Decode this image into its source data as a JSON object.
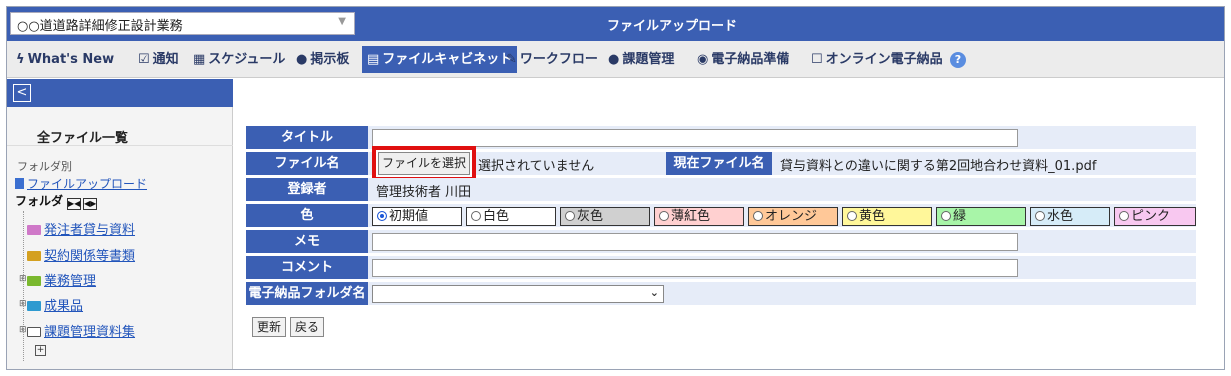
{
  "header": {
    "project": "○○道道路詳細修正設計業務",
    "page_title": "ファイルアップロード"
  },
  "nav": {
    "items": [
      {
        "icon": "ϟ",
        "label": "What's New"
      },
      {
        "icon": "☑",
        "label": "通知"
      },
      {
        "icon": "▦",
        "label": "スケジュール"
      },
      {
        "icon": "●",
        "label": "掲示板"
      },
      {
        "icon": "▤",
        "label": "ファイルキャビネット"
      },
      {
        "icon": "✎",
        "label": "ワークフロー"
      },
      {
        "icon": "●",
        "label": "課題管理"
      },
      {
        "icon": "◉",
        "label": "電子納品準備"
      },
      {
        "icon": "☐",
        "label": "オンライン電子納品"
      }
    ],
    "help": "?"
  },
  "sidebar": {
    "toggle": "<",
    "all_files": "全ファイル一覧",
    "by_folder": "フォルダ別",
    "upload_link": "ファイルアップロード",
    "folder_label": "フォルダ",
    "folder_buttons": [
      "▶◀",
      "◀▶"
    ],
    "tree": [
      {
        "label": "発注者貸与資料",
        "color": "#cf78c8"
      },
      {
        "label": "契約関係等書類",
        "color": "#d4a020"
      },
      {
        "label": "業務管理",
        "color": "#7ab82e"
      },
      {
        "label": "成果品",
        "color": "#2e9ad0"
      },
      {
        "label": "課題管理資料集",
        "color": "#ffffff"
      }
    ]
  },
  "form": {
    "title_label": "タイトル",
    "title_value": "",
    "filename_label": "ファイル名",
    "choose_file": "ファイルを選択",
    "no_file": "選択されていません",
    "current_file_label": "現在ファイル名",
    "current_file": "貸与資料との違いに関する第2回地合わせ資料_01.pdf",
    "registrant_label": "登録者",
    "registrant": "管理技術者 川田",
    "color_label": "色",
    "colors": [
      {
        "label": "初期値",
        "bg": "#ffffff",
        "selected": true
      },
      {
        "label": "白色",
        "bg": "#ffffff",
        "selected": false
      },
      {
        "label": "灰色",
        "bg": "#d0d0d0",
        "selected": false
      },
      {
        "label": "薄紅色",
        "bg": "#ffd0d0",
        "selected": false
      },
      {
        "label": "オレンジ",
        "bg": "#ffc898",
        "selected": false
      },
      {
        "label": "黄色",
        "bg": "#fff79a",
        "selected": false
      },
      {
        "label": "緑",
        "bg": "#a8f5a8",
        "selected": false
      },
      {
        "label": "水色",
        "bg": "#d6ecf8",
        "selected": false
      },
      {
        "label": "ピンク",
        "bg": "#f8c8f0",
        "selected": false
      }
    ],
    "memo_label": "メモ",
    "memo_value": "",
    "comment_label": "コメント",
    "comment_value": "",
    "folder_label": "電子納品フォルダ名",
    "folder_value": "",
    "update_button": "更新",
    "back_button": "戻る"
  }
}
